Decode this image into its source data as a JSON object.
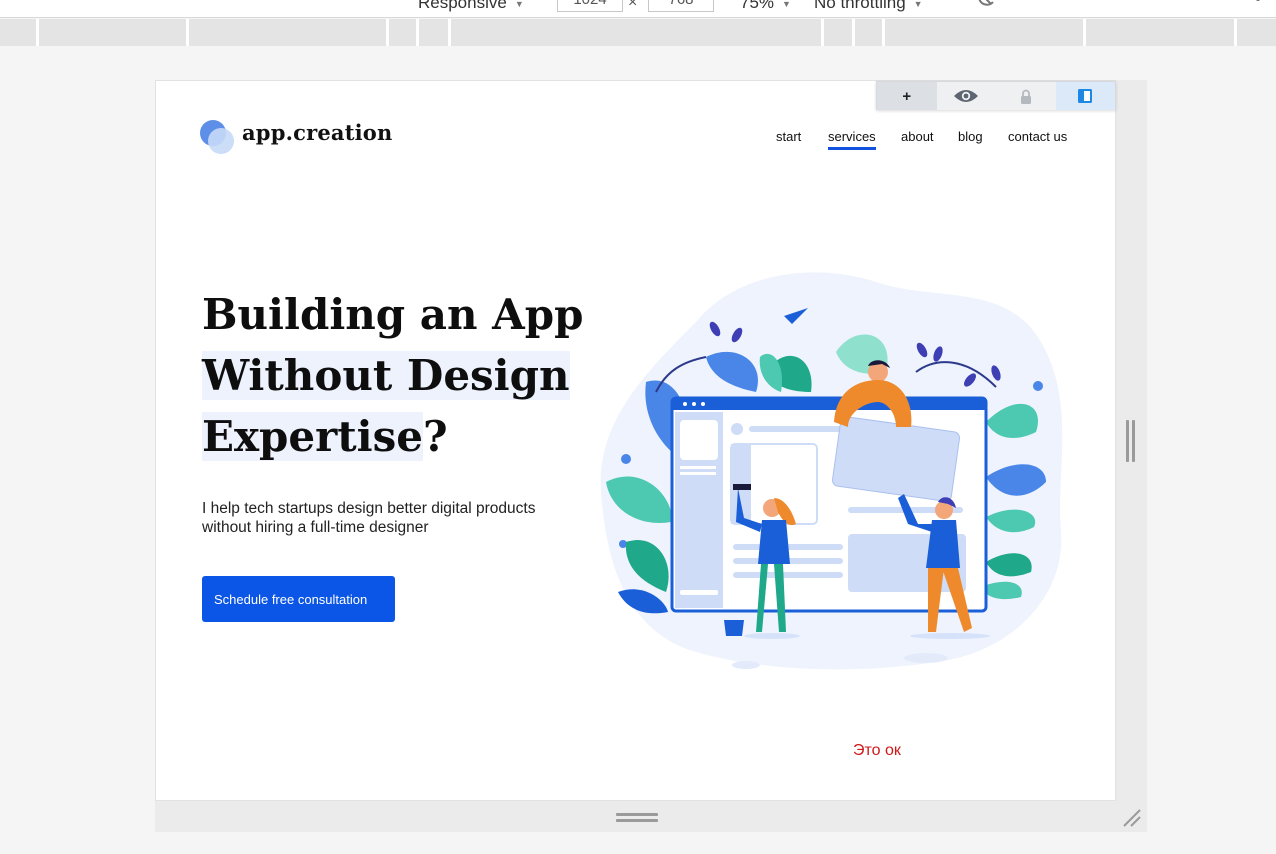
{
  "devtools": {
    "device_mode": "Responsive",
    "width": "1024",
    "height": "768",
    "zoom": "75%",
    "throttling": "No throttling",
    "times": "×"
  },
  "extension_toolbar": {
    "add_label": "+",
    "icons": [
      "plus-icon",
      "eye-icon",
      "lock-icon",
      "panel-icon"
    ]
  },
  "site": {
    "logo_text": "app.creation",
    "nav": [
      {
        "label": "start",
        "active": false
      },
      {
        "label": "services",
        "active": true
      },
      {
        "label": "about",
        "active": false
      },
      {
        "label": "blog",
        "active": false
      },
      {
        "label": "contact us",
        "active": false
      }
    ],
    "hero": {
      "title_line1": "Building an App",
      "title_line2": "Without Design",
      "title_line3": "Expertise",
      "title_end": "?",
      "subtitle": "I help tech startups design better digital products without hiring a full-time designer",
      "cta_label": "Schedule free consultation"
    },
    "note": "Это ок"
  },
  "colors": {
    "brand_blue": "#0b56e6",
    "nav_active": "#1152de",
    "note_red": "#d01818",
    "highlight": "#edf2fc"
  }
}
